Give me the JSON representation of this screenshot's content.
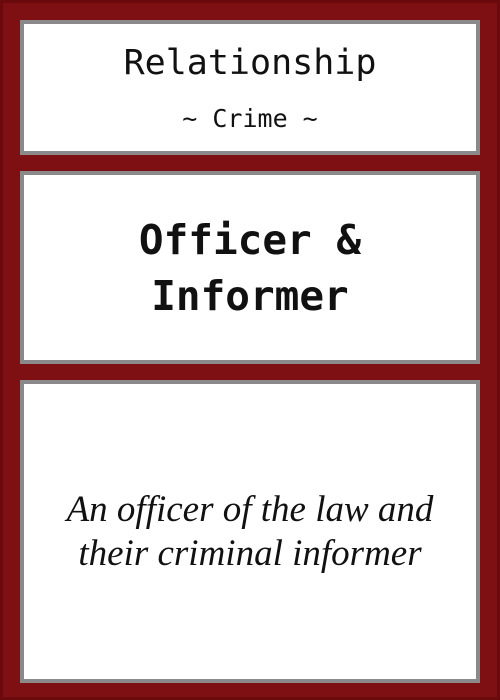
{
  "card": {
    "category": "Relationship",
    "subcategory": "~ Crime ~",
    "name_line1": "Officer &",
    "name_line2": "Informer",
    "description_line1": "An officer of the law and",
    "description_line2": "their criminal informer"
  },
  "colors": {
    "frame": "#7e0f12",
    "panel_border": "#8a8a8a",
    "panel_fill": "#ffffff",
    "text": "#111111"
  }
}
